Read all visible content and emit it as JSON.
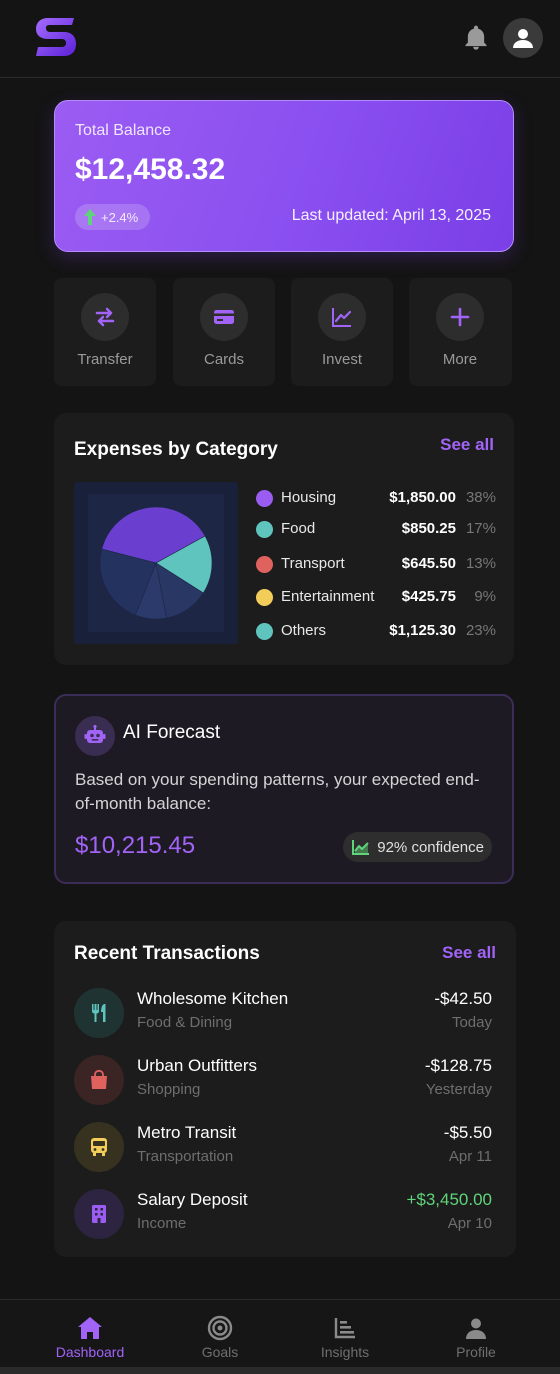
{
  "header": {
    "logo_icon": "app-logo-s",
    "notification_icon": "bell-icon",
    "profile_icon": "user-icon"
  },
  "balance": {
    "label": "Total Balance",
    "amount": "$12,458.32",
    "change": "+2.4%",
    "updated": "Last updated: April 13, 2025"
  },
  "quick_actions": [
    {
      "label": "Transfer",
      "icon": "transfer-icon"
    },
    {
      "label": "Cards",
      "icon": "card-icon"
    },
    {
      "label": "Invest",
      "icon": "chart-line-icon"
    },
    {
      "label": "More",
      "icon": "plus-icon"
    }
  ],
  "expenses": {
    "title": "Expenses by Category",
    "see_all": "See all",
    "categories": [
      {
        "name": "Housing",
        "amount": "$1,850.00",
        "percent": "38%",
        "color": "#9b5cf2"
      },
      {
        "name": "Food",
        "amount": "$850.25",
        "percent": "17%",
        "color": "#5ec4bd"
      },
      {
        "name": "Transport",
        "amount": "$645.50",
        "percent": "13%",
        "color": "#e0625f"
      },
      {
        "name": "Entertainment",
        "amount": "$425.75",
        "percent": "9%",
        "color": "#f2cd5a"
      },
      {
        "name": "Others",
        "amount": "$1,125.30",
        "percent": "23%",
        "color": "#5ec4bd"
      }
    ]
  },
  "chart_data": {
    "type": "pie",
    "categories": [
      "Housing",
      "Food",
      "Transport",
      "Entertainment",
      "Others"
    ],
    "values": [
      38,
      17,
      13,
      9,
      23
    ],
    "colors": [
      "#6a3fd0",
      "#5ec4bd",
      "#283764",
      "#2b3a6a",
      "#243260"
    ]
  },
  "forecast": {
    "title": "AI Forecast",
    "description": "Based on your spending patterns, your expected end-of-month balance:",
    "amount": "$10,215.45",
    "confidence": "92% confidence",
    "icon": "robot-icon"
  },
  "transactions": {
    "title": "Recent Transactions",
    "see_all": "See all",
    "items": [
      {
        "name": "Wholesome Kitchen",
        "category": "Food & Dining",
        "amount": "-$42.50",
        "date": "Today",
        "icon": "utensils-icon",
        "color": "#5ec4bd",
        "bg": "#1f3432",
        "positive": false
      },
      {
        "name": "Urban Outfitters",
        "category": "Shopping",
        "amount": "-$128.75",
        "date": "Yesterday",
        "icon": "shopping-bag-icon",
        "color": "#e0625f",
        "bg": "#3a2424",
        "positive": false
      },
      {
        "name": "Metro Transit",
        "category": "Transportation",
        "amount": "-$5.50",
        "date": "Apr 11",
        "icon": "bus-icon",
        "color": "#f2cd5a",
        "bg": "#36321f",
        "positive": false
      },
      {
        "name": "Salary Deposit",
        "category": "Income",
        "amount": "+$3,450.00",
        "date": "Apr 10",
        "icon": "building-icon",
        "color": "#9b5cf2",
        "bg": "#2c2440",
        "positive": true
      }
    ]
  },
  "nav": {
    "items": [
      {
        "label": "Dashboard",
        "icon": "home-icon",
        "active": true
      },
      {
        "label": "Goals",
        "icon": "target-icon",
        "active": false
      },
      {
        "label": "Insights",
        "icon": "bar-chart-icon",
        "active": false
      },
      {
        "label": "Profile",
        "icon": "user-icon",
        "active": false
      }
    ]
  }
}
